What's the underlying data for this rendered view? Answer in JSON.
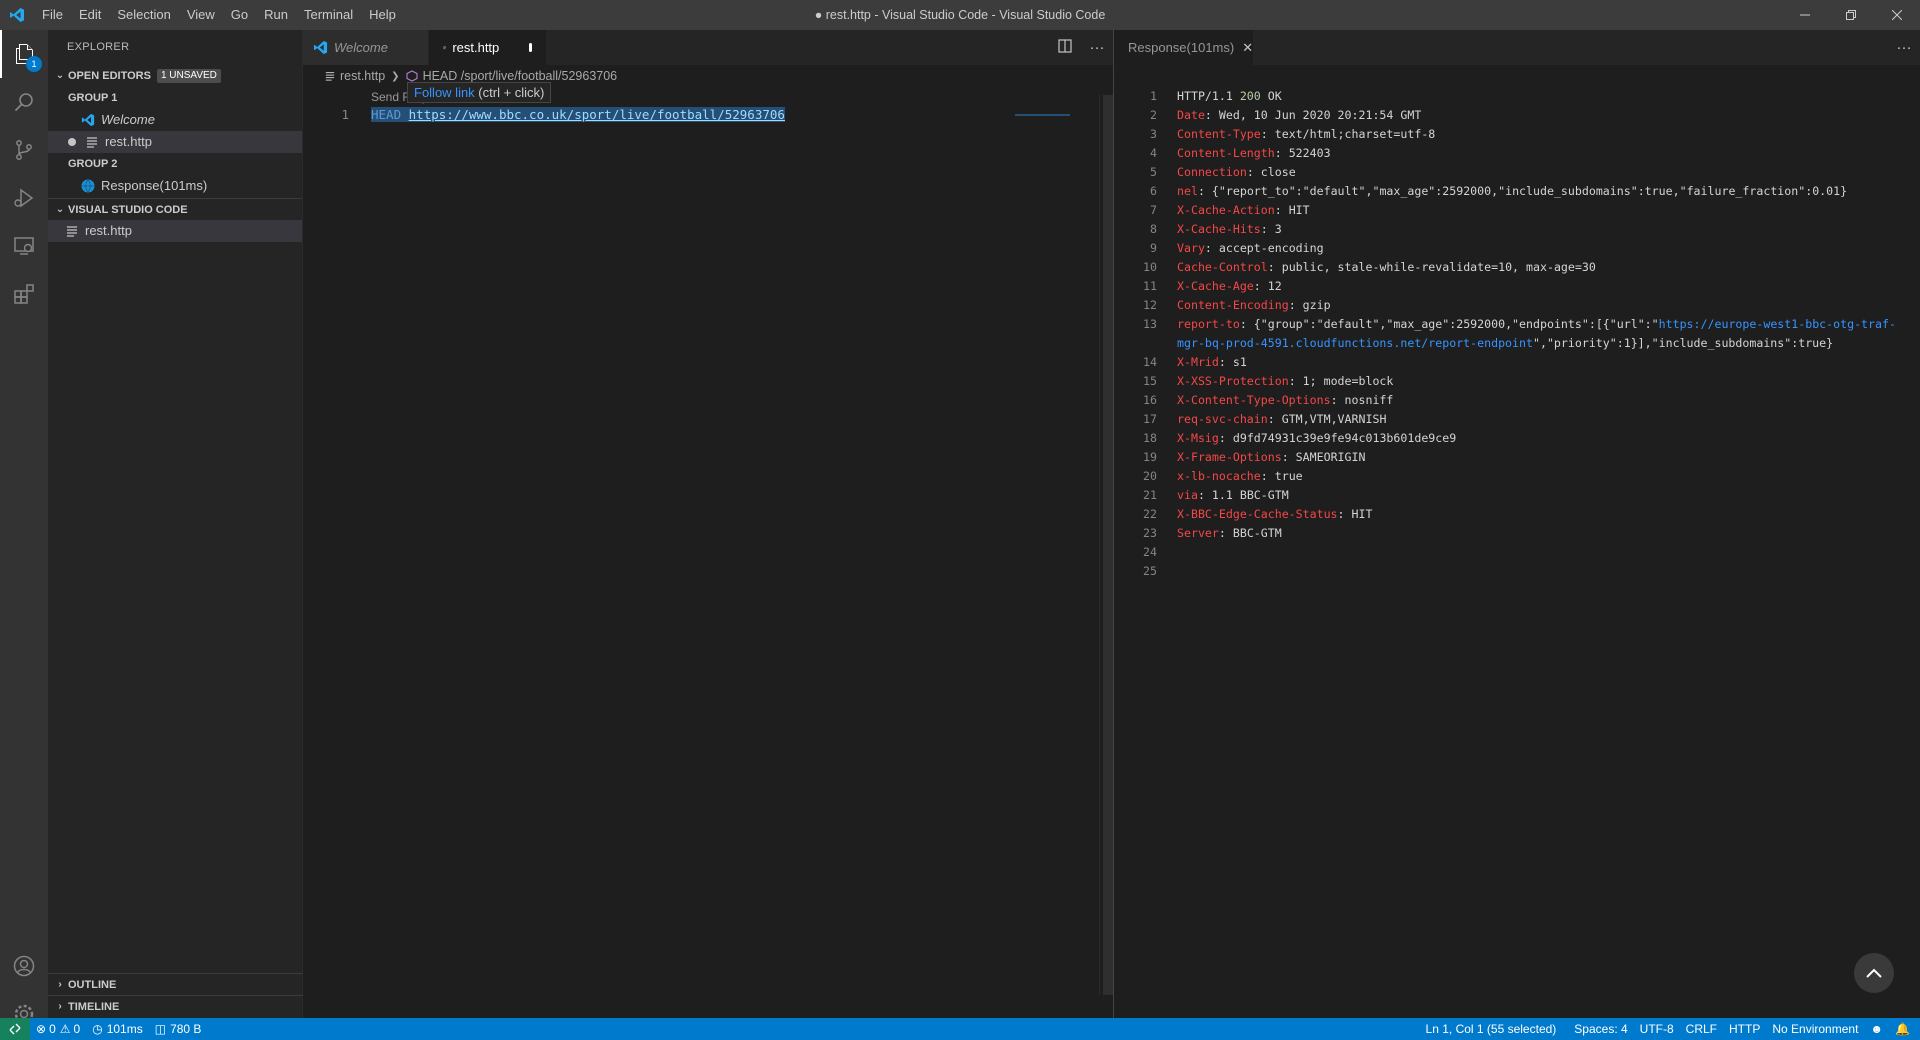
{
  "window": {
    "title": "● rest.http - Visual Studio Code - Visual Studio Code"
  },
  "menu": [
    "File",
    "Edit",
    "Selection",
    "View",
    "Go",
    "Run",
    "Terminal",
    "Help"
  ],
  "activity": {
    "explorer_badge": "1"
  },
  "sidebar": {
    "title": "EXPLORER",
    "open_editors": {
      "label": "OPEN EDITORS",
      "unsaved_badge": "1 UNSAVED",
      "group1_label": "GROUP 1",
      "group1_items": [
        "Welcome",
        "rest.http"
      ],
      "group2_label": "GROUP 2",
      "group2_items": [
        "Response(101ms)"
      ]
    },
    "workspace": {
      "label": "VISUAL STUDIO CODE",
      "items": [
        "rest.http"
      ]
    },
    "outline_label": "OUTLINE",
    "timeline_label": "TIMELINE"
  },
  "editor1": {
    "tabs": [
      {
        "label": "Welcome",
        "active": false
      },
      {
        "label": "rest.http",
        "active": true,
        "dirty": true
      }
    ],
    "breadcrumb": {
      "file": "rest.http",
      "symbol": "HEAD /sport/live/football/52963706"
    },
    "codelens": "Send Request",
    "hover": {
      "link_text": "Follow link",
      "hint": " (ctrl + click)"
    },
    "lines": [
      {
        "num": "1",
        "method": "HEAD",
        "url": "https://www.bbc.co.uk/sport/live/football/52963706"
      }
    ]
  },
  "editor2": {
    "tab_label": "Response(101ms)",
    "lines": [
      {
        "num": "1",
        "key": "HTTP/1.1",
        "code": "200",
        "value": "OK",
        "status": true
      },
      {
        "num": "2",
        "key": "Date",
        "value": "Wed, 10 Jun 2020 20:21:54 GMT"
      },
      {
        "num": "3",
        "key": "Content-Type",
        "value": "text/html;charset=utf-8"
      },
      {
        "num": "4",
        "key": "Content-Length",
        "value": "522403"
      },
      {
        "num": "5",
        "key": "Connection",
        "value": "close"
      },
      {
        "num": "6",
        "key": "nel",
        "value": "{\"report_to\":\"default\",\"max_age\":2592000,\"include_subdomains\":true,\"failure_fraction\":0.01}"
      },
      {
        "num": "7",
        "key": "X-Cache-Action",
        "value": "HIT"
      },
      {
        "num": "8",
        "key": "X-Cache-Hits",
        "value": "3"
      },
      {
        "num": "9",
        "key": "Vary",
        "value": "accept-encoding"
      },
      {
        "num": "10",
        "key": "Cache-Control",
        "value": "public, stale-while-revalidate=10, max-age=30"
      },
      {
        "num": "11",
        "key": "X-Cache-Age",
        "value": "12"
      },
      {
        "num": "12",
        "key": "Content-Encoding",
        "value": "gzip"
      },
      {
        "num": "13",
        "key": "report-to",
        "value_pre": "{\"group\":\"default\",\"max_age\":2592000,\"endpoints\":[{\"url\":\"",
        "link": "https://europe-west1-bbc-otg-traf-mgr-bq-prod-4591.cloudfunctions.net/report-endpoint",
        "value_post": "\",\"priority\":1}],\"include_subdomains\":true}"
      },
      {
        "num": "14",
        "key": "X-Mrid",
        "value": "s1"
      },
      {
        "num": "15",
        "key": "X-XSS-Protection",
        "value": "1; mode=block"
      },
      {
        "num": "16",
        "key": "X-Content-Type-Options",
        "value": "nosniff"
      },
      {
        "num": "17",
        "key": "req-svc-chain",
        "value": "GTM,VTM,VARNISH"
      },
      {
        "num": "18",
        "key": "X-Msig",
        "value": "d9fd74931c39e9fe94c013b601de9ce9"
      },
      {
        "num": "19",
        "key": "X-Frame-Options",
        "value": "SAMEORIGIN"
      },
      {
        "num": "20",
        "key": "x-lb-nocache",
        "value": "true"
      },
      {
        "num": "21",
        "key": "via",
        "value": "1.1 BBC-GTM"
      },
      {
        "num": "22",
        "key": "X-BBC-Edge-Cache-Status",
        "value": "HIT"
      },
      {
        "num": "23",
        "key": "Server",
        "value": "BBC-GTM"
      },
      {
        "num": "24"
      },
      {
        "num": "25"
      }
    ]
  },
  "statusbar": {
    "errors": "0",
    "warnings": "0",
    "time": "101ms",
    "size": "780 B",
    "position": "Ln 1, Col 1 (55 selected)",
    "spaces": "Spaces: 4",
    "encoding": "UTF-8",
    "eol": "CRLF",
    "language": "HTTP",
    "environment": "No Environment"
  },
  "colors": {
    "accent": "#007acc",
    "header_key": "#f44747",
    "link": "#3794ff"
  }
}
